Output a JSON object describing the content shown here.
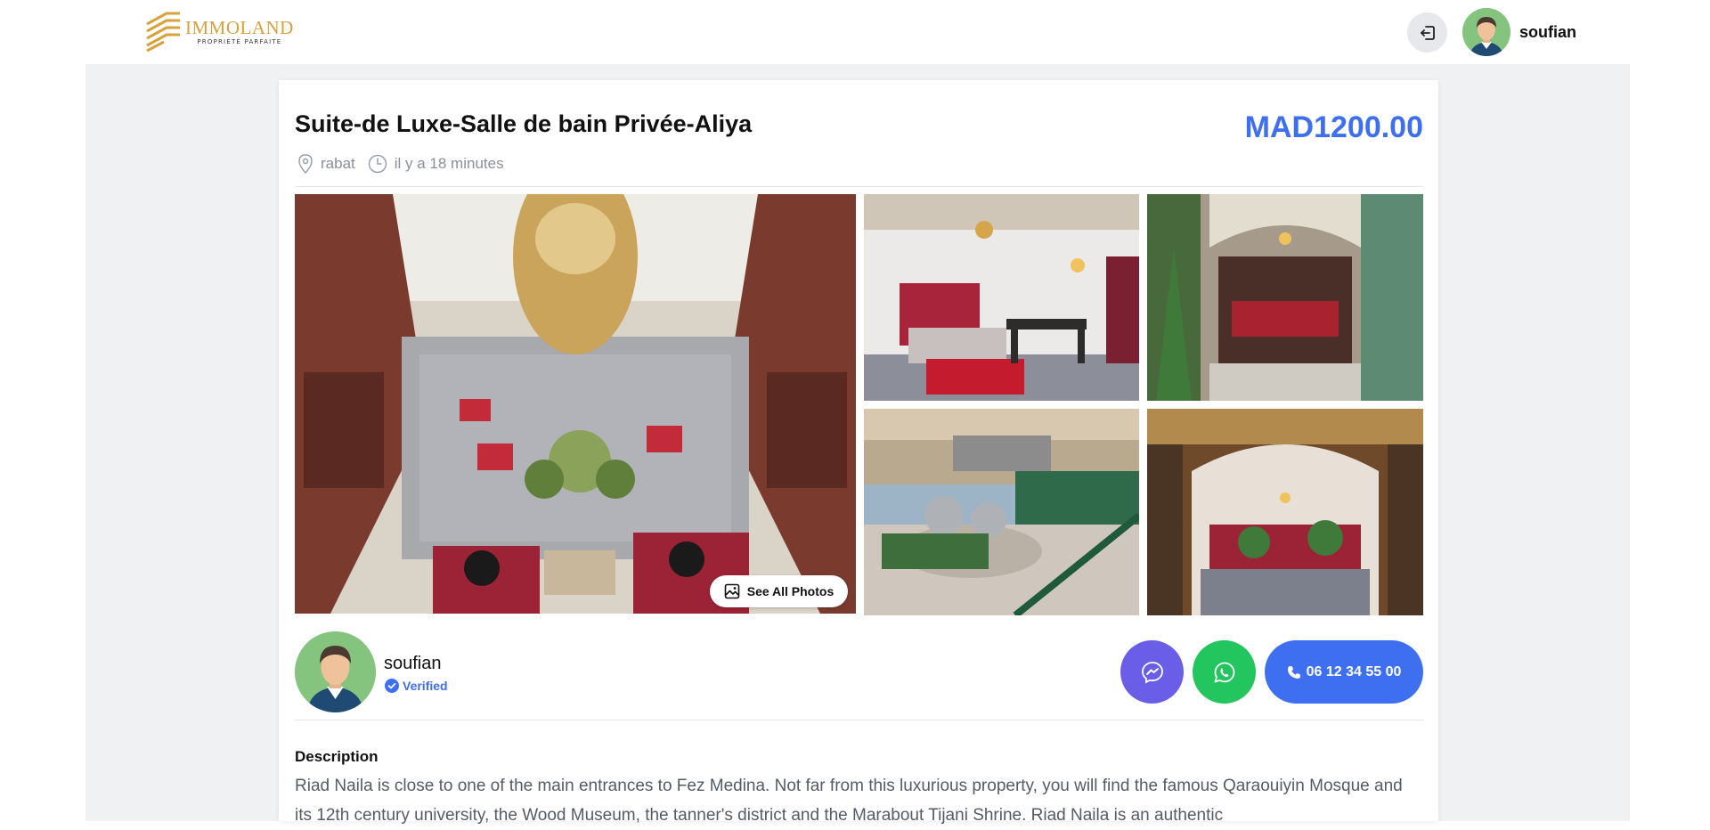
{
  "header": {
    "logo": {
      "name": "IMMOLAND",
      "tagline": "PROPRIÉTÉ PARFAITE"
    },
    "logout_icon": "logout-icon",
    "user": {
      "name": "soufian"
    }
  },
  "listing": {
    "title": "Suite-de Luxe-Salle de bain Privée-Aliya",
    "price": "MAD1200.00",
    "location": "rabat",
    "time_ago": "il y a 18 minutes",
    "see_all_photos_label": "See All Photos"
  },
  "owner": {
    "name": "soufian",
    "verified_label": "Verified"
  },
  "contact": {
    "phone": "06 12 34 55 00"
  },
  "description": {
    "title": "Description",
    "text": "Riad Naila is close to one of the main entrances to Fez Medina. Not far from this luxurious property, you will find the famous Qaraouiyin Mosque and its 12th century university, the Wood Museum, the tanner's district and the Marabout Tijani Shrine. Riad Naila is an authentic"
  },
  "colors": {
    "accent": "#3d6ff0",
    "messenger": "#6a5ee8",
    "whatsapp": "#22c55e",
    "logo_gold": "#d7a23b"
  }
}
